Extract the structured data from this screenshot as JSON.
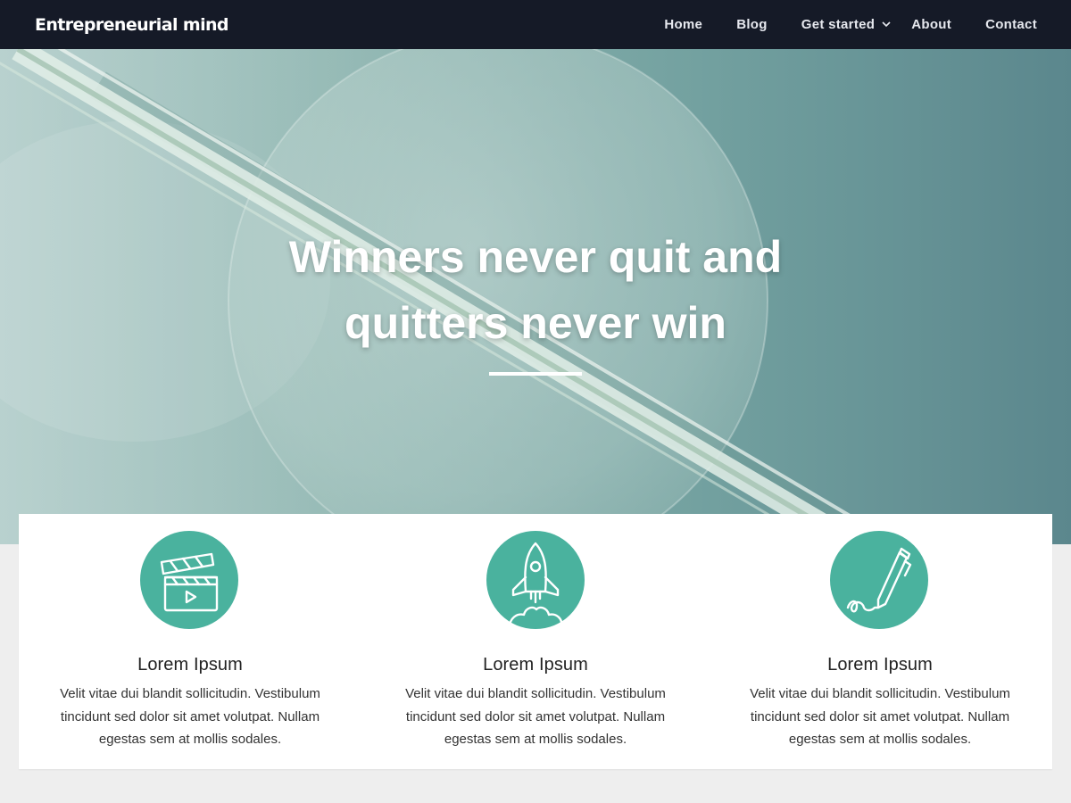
{
  "site": {
    "title": "Entrepreneurial mind"
  },
  "nav": {
    "items": [
      {
        "label": "Home"
      },
      {
        "label": "Blog"
      },
      {
        "label": "Get started",
        "has_submenu": true,
        "icon": "chevron-down-icon"
      },
      {
        "label": "About"
      },
      {
        "label": "Contact"
      }
    ]
  },
  "hero": {
    "title": "Winners never quit and quitters never win"
  },
  "features": [
    {
      "icon": "film-clapperboard-icon",
      "title": "Lorem Ipsum",
      "text": "Velit vitae dui blandit sollicitudin. Vestibulum tincidunt sed dolor sit amet volutpat. Nullam egestas sem at mollis sodales."
    },
    {
      "icon": "rocket-icon",
      "title": "Lorem Ipsum",
      "text": "Velit vitae dui blandit sollicitudin. Vestibulum tincidunt sed dolor sit amet volutpat. Nullam egestas sem at mollis sodales."
    },
    {
      "icon": "pen-signature-icon",
      "title": "Lorem Ipsum",
      "text": "Velit vitae dui blandit sollicitudin. Vestibulum tincidunt sed dolor sit amet volutpat. Nullam egestas sem at mollis sodales."
    }
  ],
  "colors": {
    "header_bg": "#151a27",
    "accent": "#4ab29e",
    "page_bg": "#eeeeee",
    "hero_tint": "#73a1a0"
  }
}
